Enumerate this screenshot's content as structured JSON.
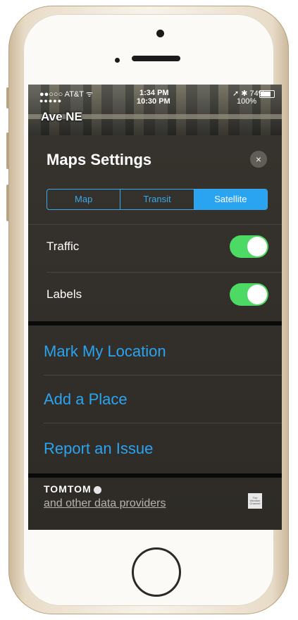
{
  "status_bar": {
    "carrier": "●●○○○ AT&T ᯤ",
    "carrier_extra": "●●●●●",
    "time_primary": "1:34 PM",
    "time_secondary": "10:30 PM",
    "battery_primary": "➚ ✱ 74%",
    "battery_secondary": "100%"
  },
  "map": {
    "street_label": "Ave NE"
  },
  "settings": {
    "title": "Maps Settings",
    "close_symbol": "×",
    "map_types": [
      {
        "label": "Map",
        "active": false
      },
      {
        "label": "Transit",
        "active": false
      },
      {
        "label": "Satellite",
        "active": true
      }
    ],
    "toggles": [
      {
        "label": "Traffic",
        "on": true
      },
      {
        "label": "Labels",
        "on": true
      }
    ],
    "actions": [
      "Mark My Location",
      "Add a Place",
      "Report an Issue"
    ]
  },
  "footer": {
    "brand": "TOMTOM",
    "data_providers_link": "and other data providers",
    "weather_logo": "The Weather Channel"
  },
  "colors": {
    "accent_blue": "#2aa4f0",
    "toggle_green": "#4cd964",
    "panel_bg": "#36322d"
  }
}
